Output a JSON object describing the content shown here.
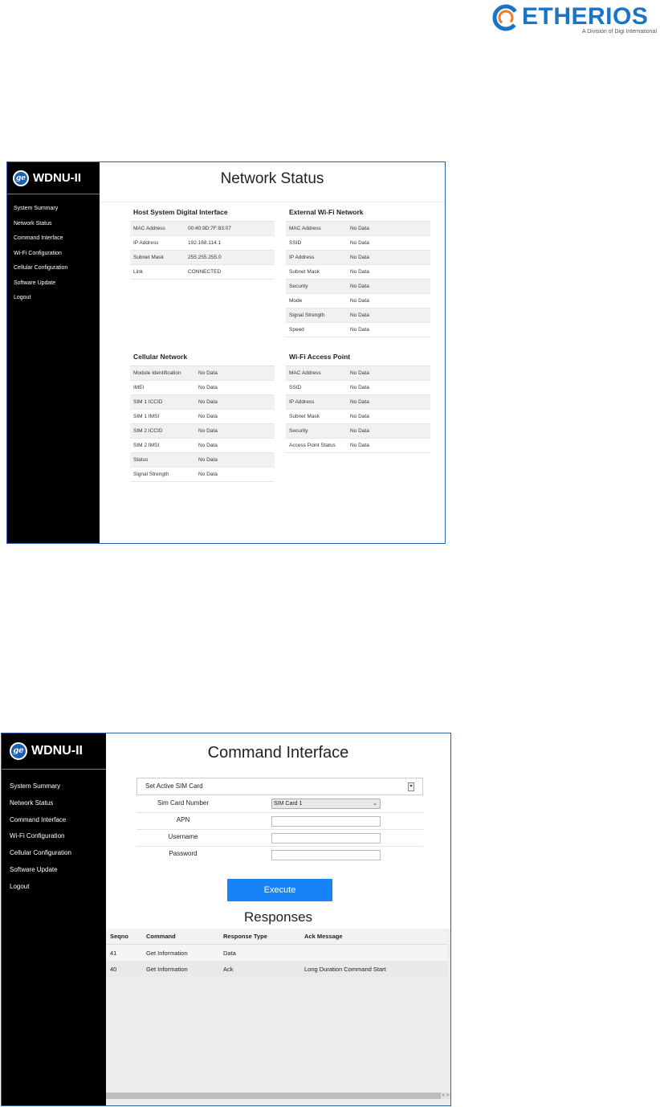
{
  "logo": {
    "word": "ETHERIOS",
    "sub": "A Division of Digi International"
  },
  "screen1": {
    "brand": "WDNU-II",
    "nav": [
      "System Summary",
      "Network Status",
      "Command Interface",
      "Wi-Fi Configuration",
      "Cellular Configuration",
      "Software Update",
      "Logout"
    ],
    "title": "Network Status",
    "panels": {
      "host": {
        "title": "Host System Digital Interface",
        "rows": [
          {
            "k": "MAC Address",
            "v": "00:40:9D:7F:83:07"
          },
          {
            "k": "IP Address",
            "v": "192.168.114.1"
          },
          {
            "k": "Subnet Mask",
            "v": "255.255.255.0"
          },
          {
            "k": "Link",
            "v": "CONNECTED"
          }
        ]
      },
      "ext": {
        "title": "External Wi-Fi Network",
        "rows": [
          {
            "k": "MAC Address",
            "v": "No Data"
          },
          {
            "k": "SSID",
            "v": "No Data"
          },
          {
            "k": "IP Address",
            "v": "No Data"
          },
          {
            "k": "Subnet Mask",
            "v": "No Data"
          },
          {
            "k": "Security",
            "v": "No Data"
          },
          {
            "k": "Mode",
            "v": "No Data"
          },
          {
            "k": "Signal Strength",
            "v": "No Data"
          },
          {
            "k": "Speed",
            "v": "No Data"
          }
        ]
      },
      "cell": {
        "title": "Cellular Network",
        "rows": [
          {
            "k": "Module Identification",
            "v": "No Data"
          },
          {
            "k": "IMEI",
            "v": "No Data"
          },
          {
            "k": "SIM 1 ICCID",
            "v": "No Data"
          },
          {
            "k": "SIM 1 IMSI",
            "v": "No Data"
          },
          {
            "k": "SIM 2 ICCID",
            "v": "No Data"
          },
          {
            "k": "SIM 2 IMSI",
            "v": "No Data"
          },
          {
            "k": "Status",
            "v": "No Data"
          },
          {
            "k": "Signal Strength",
            "v": "No Data"
          }
        ]
      },
      "ap": {
        "title": "Wi-Fi Access Point",
        "rows": [
          {
            "k": "MAC Address",
            "v": "No Data"
          },
          {
            "k": "SSID",
            "v": "No Data"
          },
          {
            "k": "IP Address",
            "v": "No Data"
          },
          {
            "k": "Subnet Mask",
            "v": "No Data"
          },
          {
            "k": "Security",
            "v": "No Data"
          },
          {
            "k": "Access Point Status",
            "v": "No Data"
          }
        ]
      }
    }
  },
  "screen2": {
    "brand": "WDNU-II",
    "nav": [
      "System Summary",
      "Network Status",
      "Command Interface",
      "Wi-Fi Configuration",
      "Cellular Configuration",
      "Software Update",
      "Logout"
    ],
    "title": "Command Interface",
    "command_select": "Set Active SIM Card",
    "form": {
      "sim_label": "Sim Card Number",
      "sim_value": "SIM Card 1",
      "apn_label": "APN",
      "apn_value": "",
      "username_label": "Username",
      "username_value": "",
      "password_label": "Password",
      "password_value": ""
    },
    "execute_label": "Execute",
    "responses_title": "Responses",
    "responses": {
      "headers": [
        "Seqno",
        "Command",
        "Response Type",
        "Ack Message"
      ],
      "rows": [
        [
          "41",
          "Get Information",
          "Data",
          ""
        ],
        [
          "40",
          "Get Information",
          "Ack",
          "Long Duration Command Start"
        ]
      ]
    }
  },
  "colors": {
    "accent_blue": "#1683f9",
    "frame_blue": "#2a5fb0",
    "sidebar_black": "#000000",
    "logo_blue": "#1b74c6"
  },
  "icons": [
    "etherios-logo-icon",
    "ge-logo-icon",
    "select-arrow-icon",
    "chevron-down-icon",
    "scroll-arrow-icon"
  ]
}
